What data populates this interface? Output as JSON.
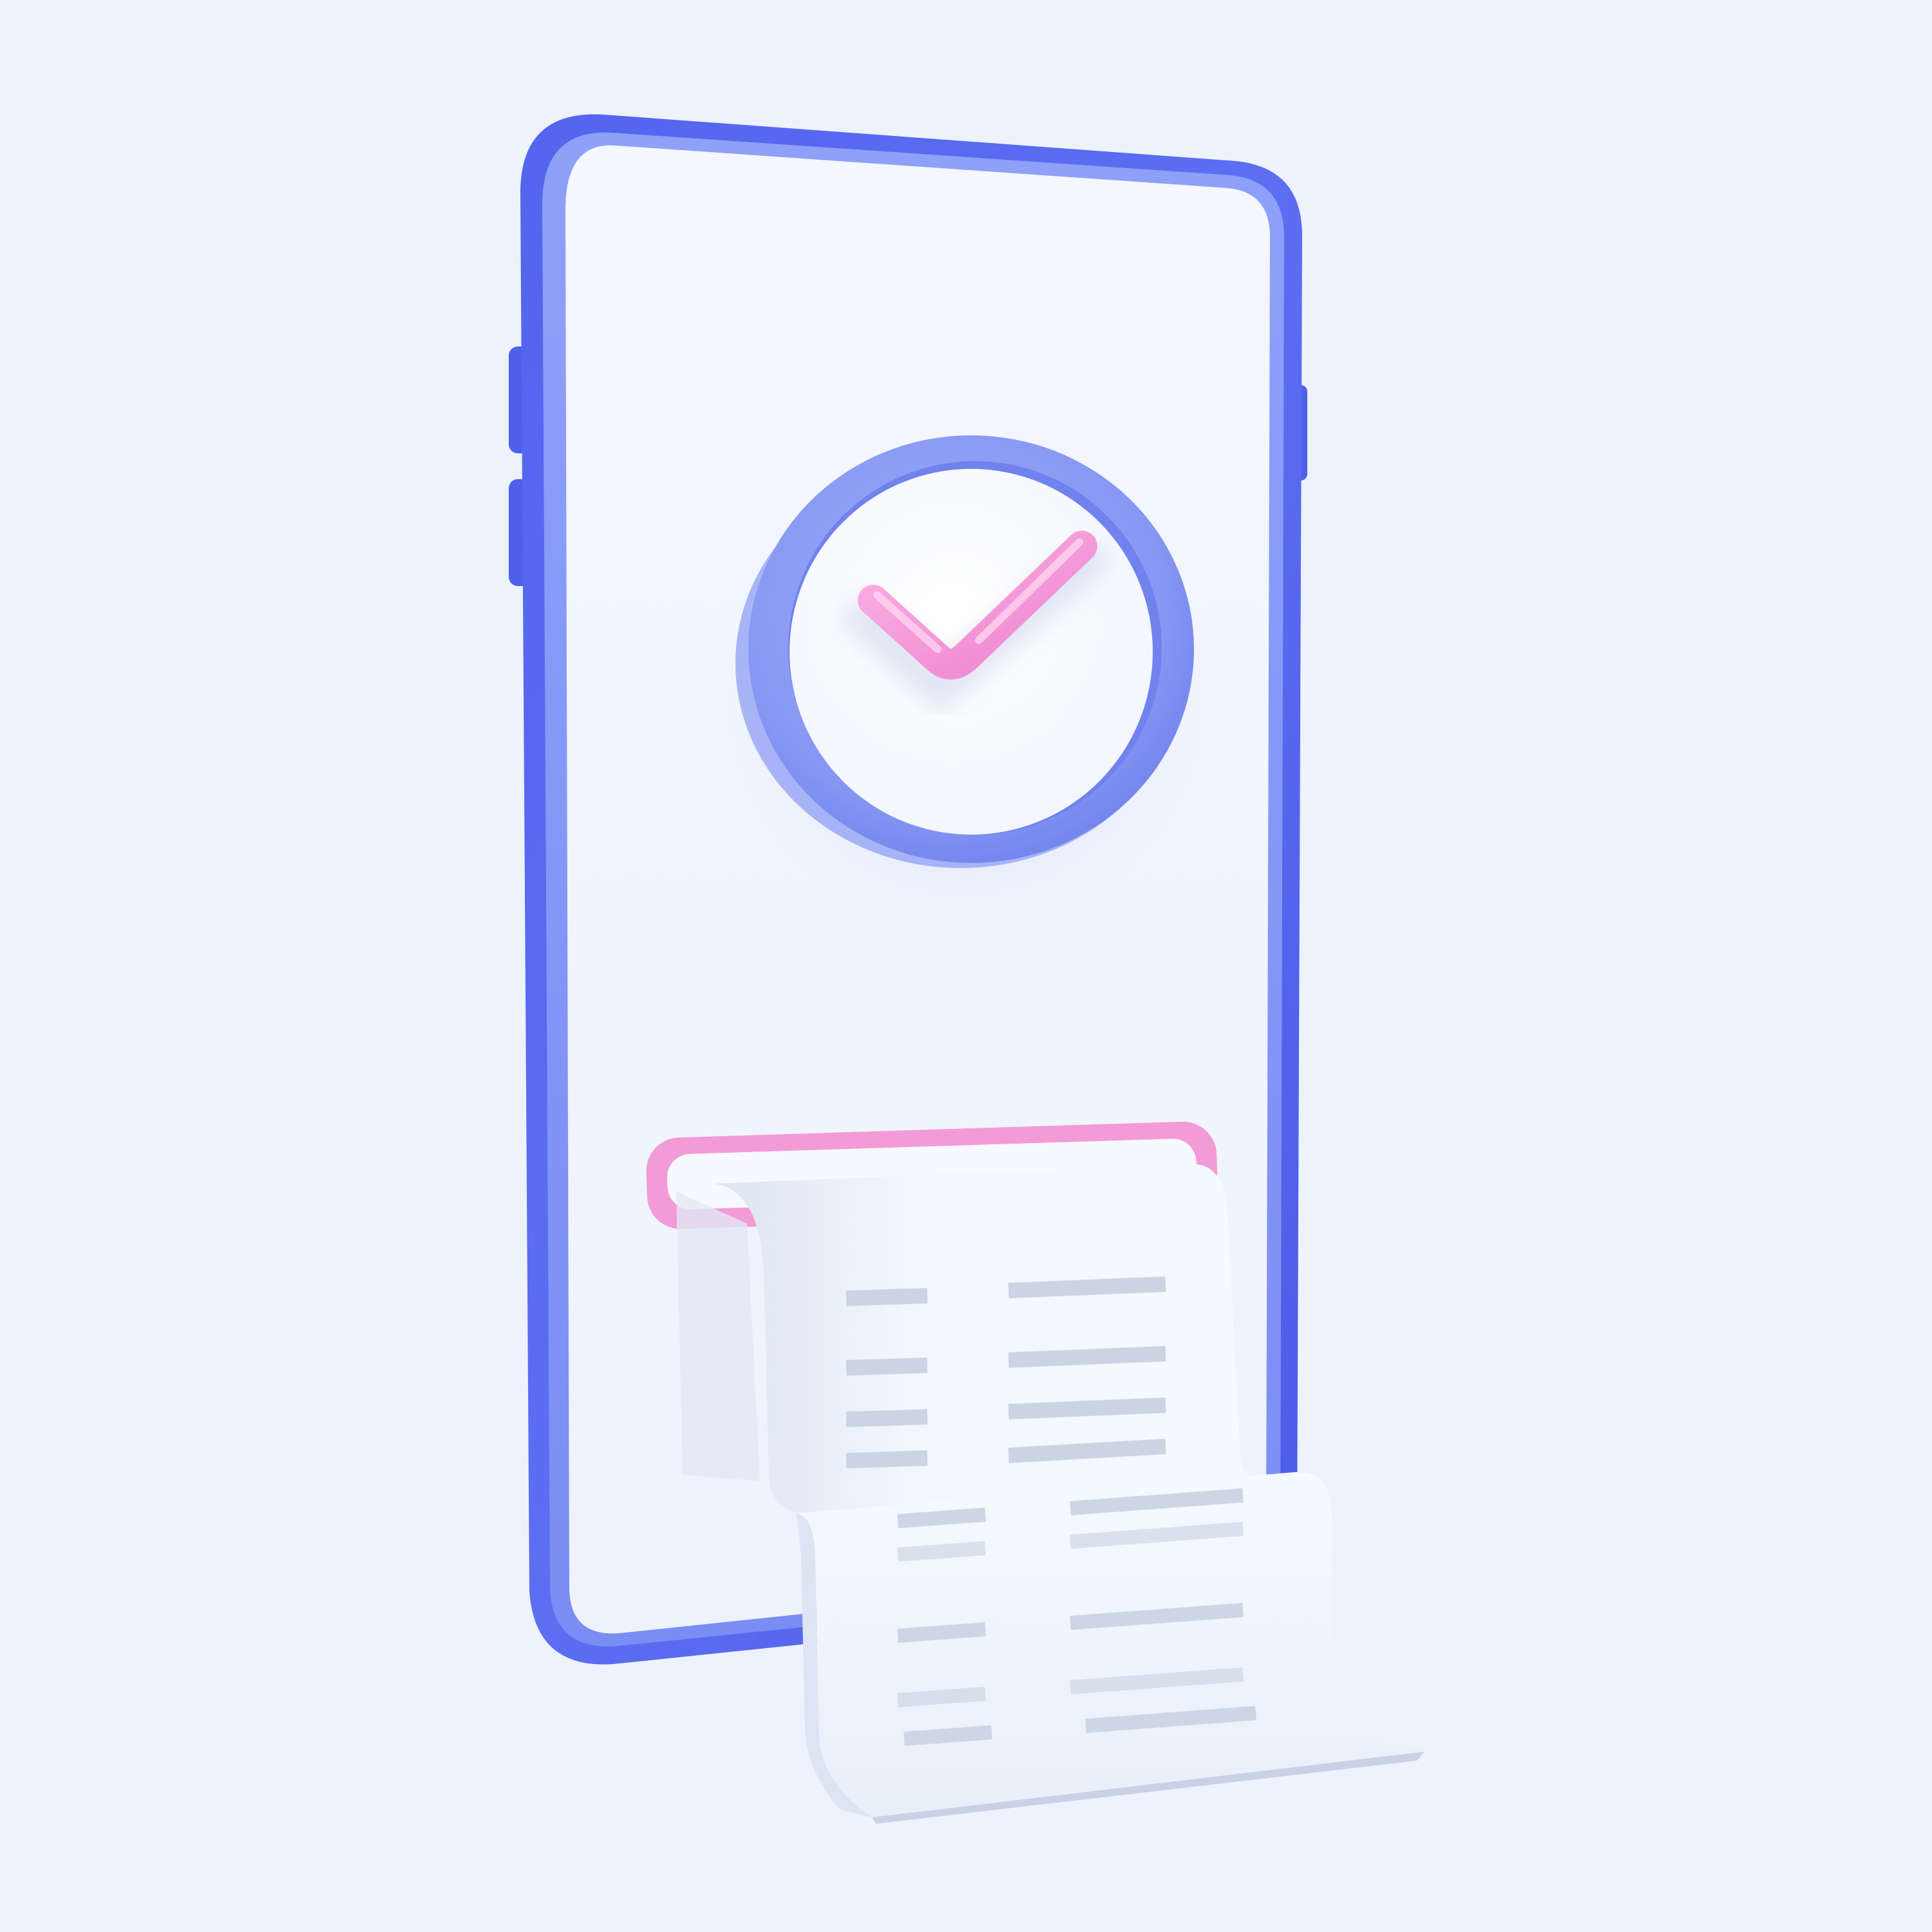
{
  "scene": {
    "subject": "payment-success-illustration",
    "background_color": "#EEF2FD",
    "phone": {
      "frame_color": "#5B6CF0",
      "frame_highlight_color": "#8A9CF8",
      "screen_color": "#F2F6FE",
      "side_buttons": 3
    },
    "status_badge": {
      "icon": "check-circle-icon",
      "ring_color": "#7E90F2",
      "face_color": "#F7FAFF",
      "check_color": "#F39AD8"
    },
    "receipt_slot": {
      "color": "#F29BD6"
    },
    "receipt": {
      "paper_color": "#F1F7FD",
      "upper_rows": 4,
      "lower_rows": 5,
      "line_color": "#C9D3E2"
    }
  }
}
